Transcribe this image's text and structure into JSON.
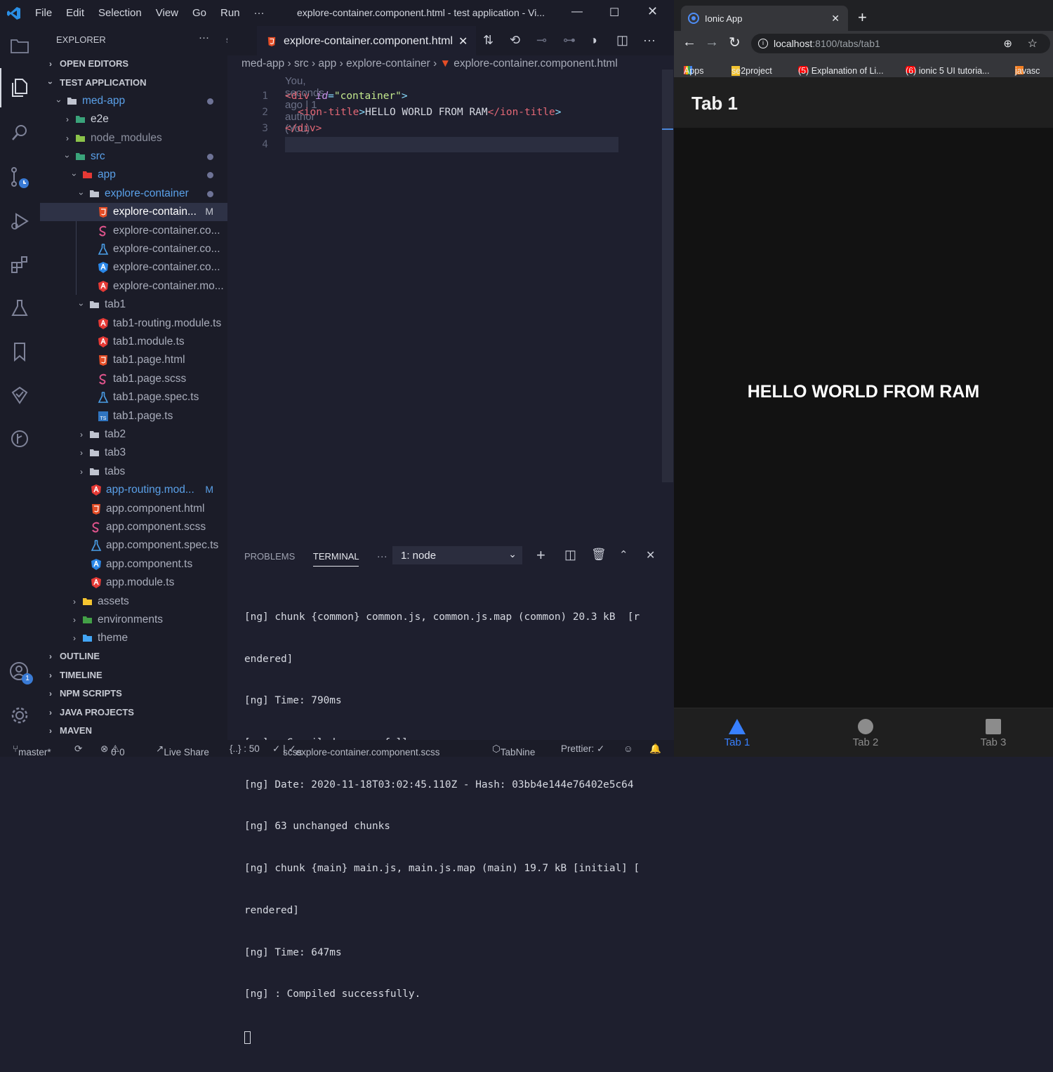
{
  "titlebar": {
    "menu": [
      "File",
      "Edit",
      "Selection",
      "View",
      "Go",
      "Run",
      "···"
    ],
    "title": "explore-container.component.html - test application - Vi..."
  },
  "sidebar": {
    "header": "EXPLORER",
    "open_editors": "OPEN EDITORS",
    "project": "TEST APPLICATION",
    "tree": [
      {
        "label": "med-app",
        "dot": true
      },
      {
        "label": "e2e"
      },
      {
        "label": "node_modules"
      },
      {
        "label": "src",
        "dot": true
      },
      {
        "label": "app",
        "dot": true
      },
      {
        "label": "explore-container",
        "dot": true
      },
      {
        "label": "explore-contain...",
        "badge": "M"
      },
      {
        "label": "explore-container.co..."
      },
      {
        "label": "explore-container.co..."
      },
      {
        "label": "explore-container.co..."
      },
      {
        "label": "explore-container.mo..."
      },
      {
        "label": "tab1"
      },
      {
        "label": "tab1-routing.module.ts"
      },
      {
        "label": "tab1.module.ts"
      },
      {
        "label": "tab1.page.html"
      },
      {
        "label": "tab1.page.scss"
      },
      {
        "label": "tab1.page.spec.ts"
      },
      {
        "label": "tab1.page.ts"
      },
      {
        "label": "tab2"
      },
      {
        "label": "tab3"
      },
      {
        "label": "tabs"
      },
      {
        "label": "app-routing.mod...",
        "badge": "M"
      },
      {
        "label": "app.component.html"
      },
      {
        "label": "app.component.scss"
      },
      {
        "label": "app.component.spec.ts"
      },
      {
        "label": "app.component.ts"
      },
      {
        "label": "app.module.ts"
      },
      {
        "label": "assets"
      },
      {
        "label": "environments"
      },
      {
        "label": "theme"
      }
    ],
    "sections": [
      "OUTLINE",
      "TIMELINE",
      "NPM SCRIPTS",
      "JAVA PROJECTS",
      "MAVEN"
    ],
    "account_badge": "1"
  },
  "editor": {
    "prev_tab": "s",
    "tab_label": "explore-container.component.html",
    "breadcrumb": [
      "med-app",
      "src",
      "app",
      "explore-container",
      "explore-container.component.html"
    ],
    "blame": "You, seconds ago | 1 author (You)",
    "line_numbers": [
      "1",
      "2",
      "3",
      "4"
    ],
    "code": {
      "l1_open": "<div ",
      "l1_attr": "id",
      "l1_eq": "=",
      "l1_val": "\"container\"",
      "l1_close": ">",
      "l2_open": "<ion-title",
      "l2_gt": ">",
      "l2_text": "HELLO WORLD FROM RAM",
      "l2_close": "</ion-title",
      "l2_end": ">",
      "l3": "</div>"
    }
  },
  "panel": {
    "tabs": [
      "PROBLEMS",
      "TERMINAL",
      "···"
    ],
    "selector": "1: node",
    "terminal_lines": [
      "[ng] chunk {common} common.js, common.js.map (common) 20.3 kB  [r",
      "endered]",
      "[ng] Time: 790ms",
      "[ng] : Compiled successfully.",
      "[ng] Date: 2020-11-18T03:02:45.110Z - Hash: 03bb4e144e76402e5c64",
      "[ng] 63 unchanged chunks",
      "[ng] chunk {main} main.js, main.js.map (main) 19.7 kB [initial] [",
      "rendered]",
      "[ng] Time: 647ms",
      "[ng] : Compiled successfully."
    ]
  },
  "statusbar": {
    "branch": "master*",
    "errors": "0",
    "warnings": "0",
    "live_share": "Live Share",
    "selection": "{..} : 50",
    "lang": "scss",
    "file": "explore-container.component.scss",
    "tabnine": "TabNine",
    "prettier": "Prettier: ✓"
  },
  "browser": {
    "tab_title": "Ionic App",
    "url_host": "localhost",
    "url_rest": ":8100/tabs/tab1",
    "bookmarks": [
      "Apps",
      "se2project",
      "(5) Explanation of Li...",
      "(6) ionic 5 UI tutoria...",
      "javasc"
    ],
    "page_title": "Tab 1",
    "content": "HELLO WORLD FROM RAM",
    "tabs": [
      "Tab 1",
      "Tab 2",
      "Tab 3"
    ],
    "active_color": "#3880ff"
  }
}
